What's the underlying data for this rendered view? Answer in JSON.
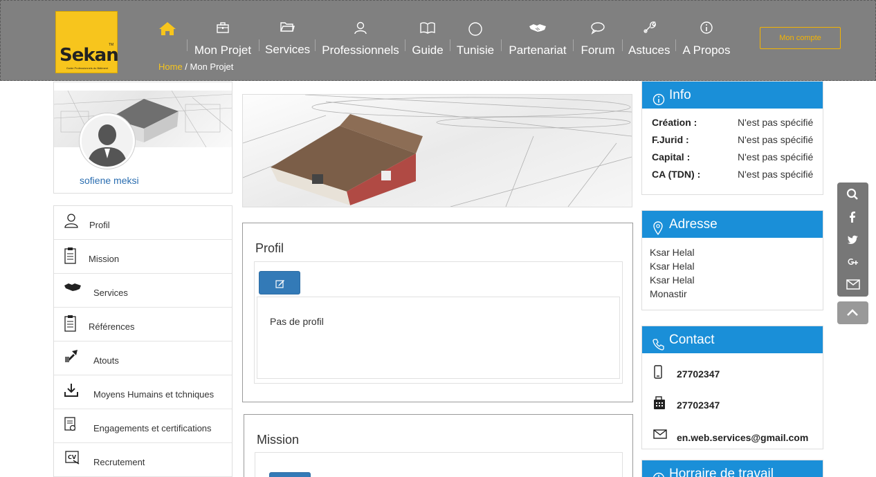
{
  "logo": {
    "text": "Sekan",
    "tm": "TM",
    "tagline": "Guide Professionnels du Bâtiment"
  },
  "nav": {
    "items": [
      {
        "label": "",
        "icon": "home-icon"
      },
      {
        "label": "Mon Projet",
        "icon": "briefcase-icon"
      },
      {
        "label": "Services",
        "icon": "folder-icon"
      },
      {
        "label": "Professionnels",
        "icon": "user-icon"
      },
      {
        "label": "Guide",
        "icon": "book-icon"
      },
      {
        "label": "Tunisie",
        "icon": "crescent-icon"
      },
      {
        "label": "Partenariat",
        "icon": "handshake-icon"
      },
      {
        "label": "Forum",
        "icon": "chat-icon"
      },
      {
        "label": "Astuces",
        "icon": "tools-icon"
      },
      {
        "label": "A Propos",
        "icon": "info-icon"
      }
    ],
    "account_button": "Mon compte"
  },
  "breadcrumb": {
    "home": "Home",
    "separator": " / ",
    "current": "Mon Projet"
  },
  "profile": {
    "name": "sofiene meksi"
  },
  "side_menu": {
    "items": [
      {
        "label": "Profil",
        "icon": "user-icon"
      },
      {
        "label": "Mission",
        "icon": "clipboard-icon"
      },
      {
        "label": "Services",
        "icon": "handshake-icon"
      },
      {
        "label": "Références",
        "icon": "clipboard-icon"
      },
      {
        "label": "Atouts",
        "icon": "tools-icon"
      },
      {
        "label": "Moyens Humains et tchniques",
        "icon": "download-icon"
      },
      {
        "label": "Engagements et certifications",
        "icon": "certificate-icon"
      },
      {
        "label": "Recrutement",
        "icon": "cv-icon"
      }
    ]
  },
  "sections": {
    "profil": {
      "title": "Profil",
      "content": "Pas de profil"
    },
    "mission": {
      "title": "Mission"
    }
  },
  "info": {
    "title": "Info",
    "rows": [
      {
        "key": "Création :",
        "value": "N'est pas spécifié"
      },
      {
        "key": "F.Jurid :",
        "value": "N'est pas spécifié"
      },
      {
        "key": "Capital :",
        "value": "N'est pas spécifié"
      },
      {
        "key": "CA (TDN) :",
        "value": "N'est pas spécifié"
      }
    ]
  },
  "address": {
    "title": "Adresse",
    "lines": [
      "Ksar Helal",
      "Ksar Helal",
      "Ksar Helal",
      "Monastir"
    ]
  },
  "contact": {
    "title": "Contact",
    "mobile": "27702347",
    "fax": "27702347",
    "email": "en.web.services@gmail.com"
  },
  "hours": {
    "title": "Horraire de travail"
  },
  "colors": {
    "accent": "#f7c51d",
    "primary": "#1a8fd8",
    "header_bg": "#808080",
    "button_blue": "#337ab7"
  }
}
